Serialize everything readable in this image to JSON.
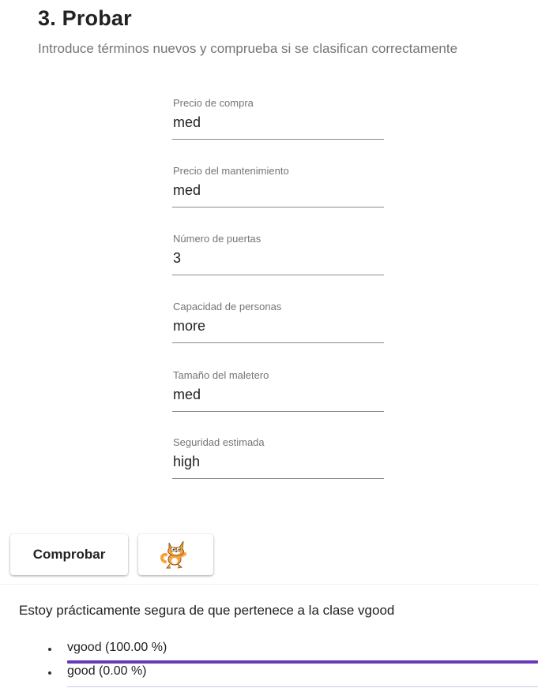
{
  "section": {
    "title": "3. Probar",
    "subtitle": "Introduce términos nuevos y comprueba si se clasifican correctamente"
  },
  "fields": [
    {
      "label": "Precio de compra",
      "value": "med"
    },
    {
      "label": "Precio del mantenimiento",
      "value": "med"
    },
    {
      "label": "Número de puertas",
      "value": "3"
    },
    {
      "label": "Capacidad de personas",
      "value": "more"
    },
    {
      "label": "Tamaño del maletero",
      "value": "med"
    },
    {
      "label": "Seguridad estimada",
      "value": "high"
    }
  ],
  "buttons": {
    "check_label": "Comprobar",
    "scratch_icon": "scratch-cat-icon"
  },
  "result": {
    "message": "Estoy prácticamente segura de que pertenece a la clase vgood",
    "probabilities": [
      {
        "label": "vgood (100.00 %)",
        "fraction": 1.0
      },
      {
        "label": "good (0.00 %)",
        "fraction": 0.0
      }
    ]
  },
  "colors": {
    "bar_fill": "#673ab7",
    "bar_track": "#d1c4e9"
  }
}
